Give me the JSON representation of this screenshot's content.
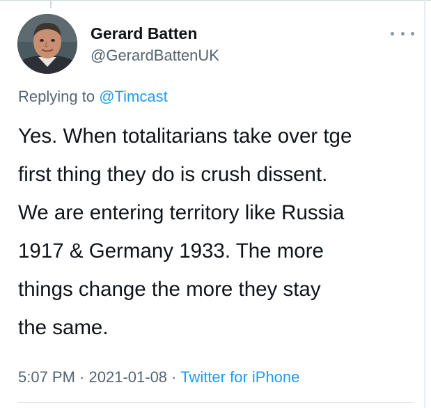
{
  "author": {
    "display_name": "Gerard Batten",
    "handle": "@GerardBattenUK"
  },
  "reply": {
    "prefix": "Replying to ",
    "mention": "@Timcast"
  },
  "tweet": {
    "lines": [
      "Yes. When totalitarians take over tge",
      "first thing they do is crush dissent.",
      "We are entering territory like Russia",
      "1917 & Germany 1933. The more",
      "things change the more they stay",
      "the same."
    ]
  },
  "meta": {
    "time": "5:07 PM",
    "separator": " · ",
    "date": "2021-01-08",
    "source": "Twitter for iPhone"
  },
  "icons": {
    "more": "more-horizontal-icon",
    "avatar": "profile-photo"
  },
  "colors": {
    "text": "#0f1419",
    "secondary": "#536471",
    "link": "#1d9bf0"
  }
}
